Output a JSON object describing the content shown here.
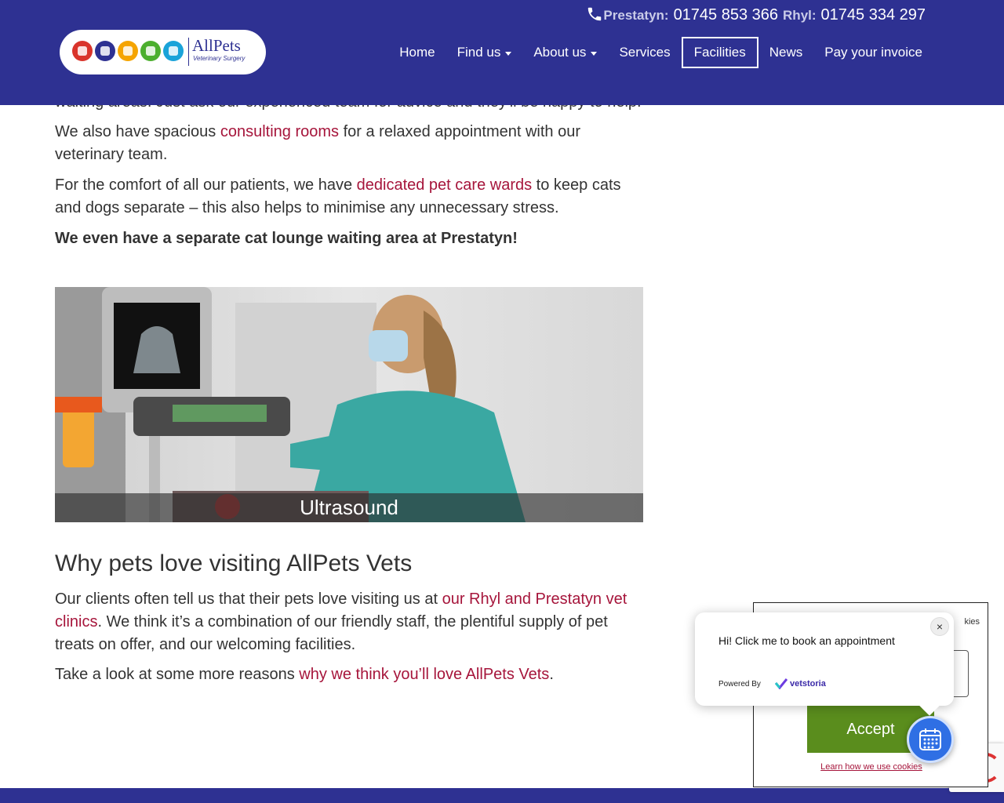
{
  "header": {
    "logo": {
      "brand": "AllPets",
      "tagline": "Veterinary Surgery",
      "icon_colors": [
        "#d9342b",
        "#2e3192",
        "#f5a400",
        "#4caf2e",
        "#1aa3d9"
      ]
    },
    "phones": [
      {
        "label": "Prestatyn:",
        "number": "01745 853 366"
      },
      {
        "label": "Rhyl:",
        "number": "01745 334 297"
      }
    ],
    "nav": [
      {
        "label": "Home"
      },
      {
        "label": "Find us"
      },
      {
        "label": "About us"
      },
      {
        "label": "Services"
      },
      {
        "label": "Facilities"
      },
      {
        "label": "News"
      },
      {
        "label": "Pay your invoice"
      }
    ],
    "active_nav": "Facilities",
    "brand_color": "#2e3192"
  },
  "content": {
    "partial_line": "waiting areas. Just ask our experienced team for advice and they'll be happy to help.",
    "p1": {
      "before": "We also have spacious ",
      "link": "consulting rooms",
      "after": " for a relaxed appointment with our veterinary team."
    },
    "p2": {
      "before": "For the comfort of all our patients, we have ",
      "link": "dedicated pet care wards",
      "after": " to keep cats and dogs separate – this also helps to minimise any unnecessary stress."
    },
    "p3": "We even have a separate cat lounge waiting area at Prestatyn!",
    "figure_caption": "Ultrasound",
    "heading": "Why pets love visiting AllPets Vets",
    "p4": {
      "before": "Our clients often tell us that their pets love visiting us at ",
      "link": "our Rhyl and Prestatyn vet clinics",
      "after": ". We think it’s a combination of our friendly staff, the plentiful supply of pet treats on offer, and our welcoming facilities."
    },
    "p5": {
      "before": "Take a look at some more reasons ",
      "link": "why we think you’ll love AllPets Vets",
      "after": "."
    },
    "link_color": "#a6153b"
  },
  "cookie": {
    "partial_text": "kies",
    "accept_label": "Accept",
    "learn_link": "Learn how we use cookies",
    "accept_color": "#5a8d1d"
  },
  "booking": {
    "message": "Hi! Click me to book an appointment",
    "powered_by": "Powered By",
    "provider": "vetstoria",
    "close": "×"
  }
}
